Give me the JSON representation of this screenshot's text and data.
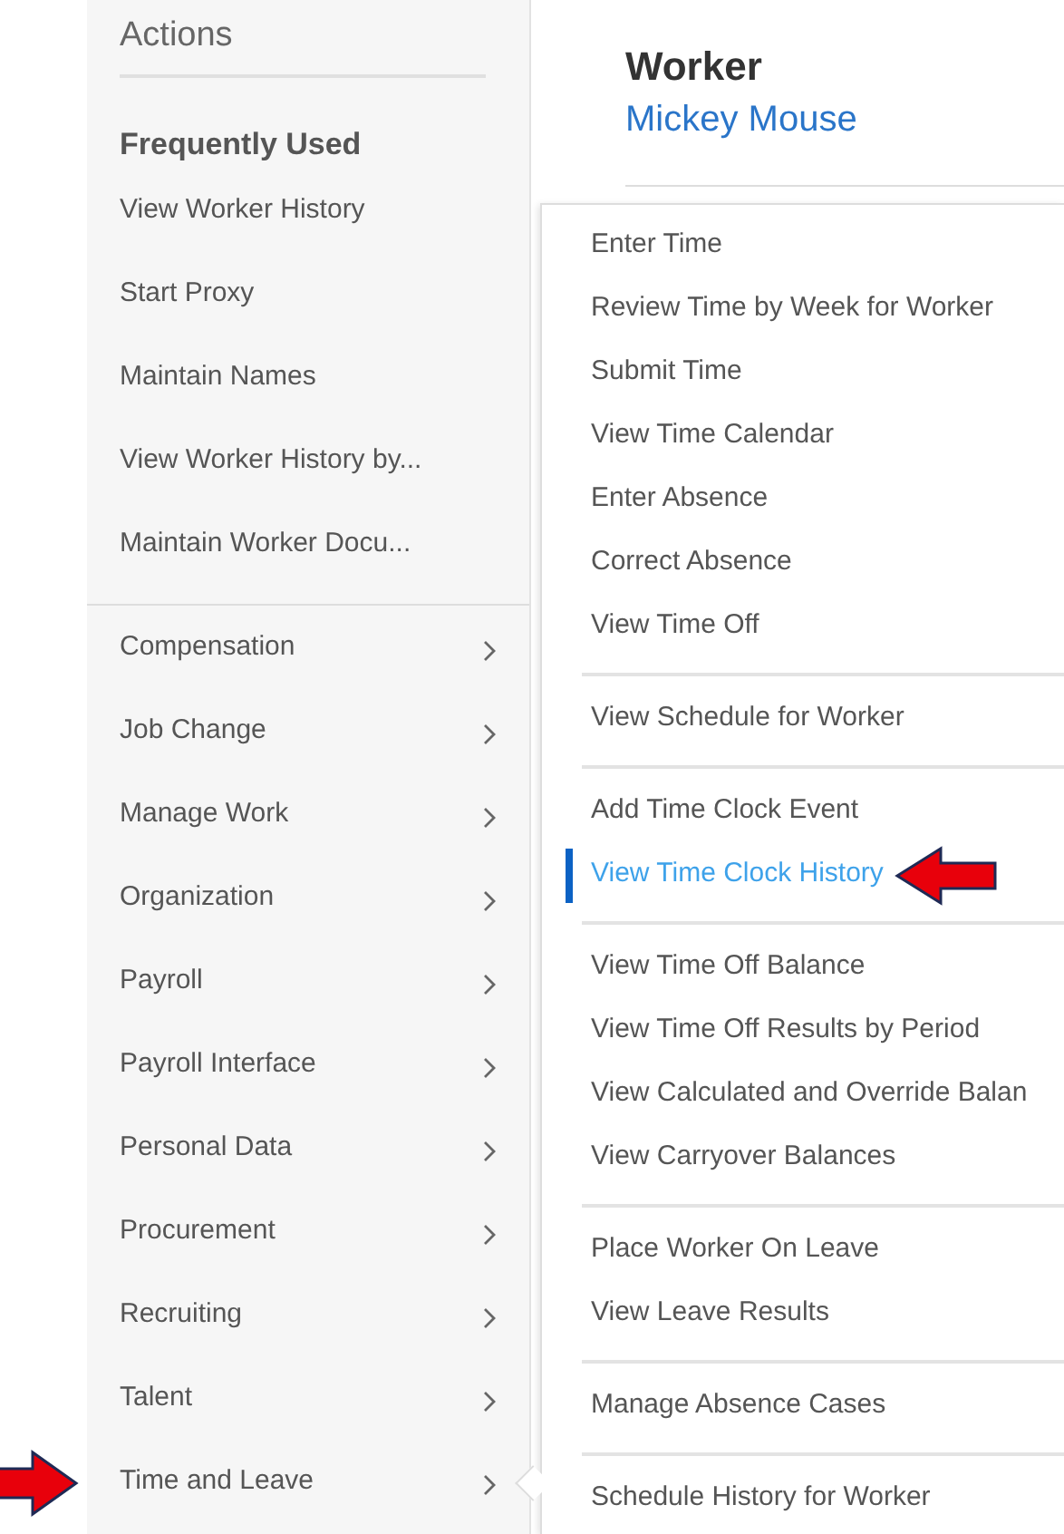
{
  "sidebar": {
    "title": "Actions",
    "section_title": "Frequently Used",
    "frequent_items": [
      "View Worker History",
      "Start Proxy",
      "Maintain Names",
      "View Worker History by...",
      "Maintain Worker Docu..."
    ],
    "categories": [
      {
        "label": "Compensation",
        "selected": false,
        "marked": false
      },
      {
        "label": "Job Change",
        "selected": false,
        "marked": false
      },
      {
        "label": "Manage Work",
        "selected": false,
        "marked": false
      },
      {
        "label": "Organization",
        "selected": false,
        "marked": false
      },
      {
        "label": "Payroll",
        "selected": false,
        "marked": false
      },
      {
        "label": "Payroll Interface",
        "selected": false,
        "marked": false
      },
      {
        "label": "Personal Data",
        "selected": false,
        "marked": false
      },
      {
        "label": "Procurement",
        "selected": false,
        "marked": false
      },
      {
        "label": "Recruiting",
        "selected": false,
        "marked": false
      },
      {
        "label": "Talent",
        "selected": false,
        "marked": false
      },
      {
        "label": "Time and Leave",
        "selected": true,
        "marked": true
      }
    ]
  },
  "header": {
    "title": "Worker",
    "name": "Mickey Mouse"
  },
  "menu": {
    "groups": [
      {
        "items": [
          {
            "label": "Enter Time",
            "selected": false,
            "marked": false
          },
          {
            "label": "Review Time by Week for Worker",
            "selected": false,
            "marked": false
          },
          {
            "label": "Submit Time",
            "selected": false,
            "marked": false
          },
          {
            "label": "View Time Calendar",
            "selected": false,
            "marked": false
          },
          {
            "label": "Enter Absence",
            "selected": false,
            "marked": false
          },
          {
            "label": "Correct Absence",
            "selected": false,
            "marked": false
          },
          {
            "label": "View Time Off",
            "selected": false,
            "marked": false
          }
        ]
      },
      {
        "items": [
          {
            "label": "View Schedule for Worker",
            "selected": false,
            "marked": false
          }
        ]
      },
      {
        "items": [
          {
            "label": "Add Time Clock Event",
            "selected": false,
            "marked": false
          },
          {
            "label": "View Time Clock History",
            "selected": true,
            "marked": true
          }
        ]
      },
      {
        "items": [
          {
            "label": "View Time Off Balance",
            "selected": false,
            "marked": false
          },
          {
            "label": "View Time Off Results by Period",
            "selected": false,
            "marked": false
          },
          {
            "label": "View Calculated and Override Balan",
            "selected": false,
            "marked": false
          },
          {
            "label": "View Carryover Balances",
            "selected": false,
            "marked": false
          }
        ]
      },
      {
        "items": [
          {
            "label": "Place Worker On Leave",
            "selected": false,
            "marked": false
          },
          {
            "label": "View Leave Results",
            "selected": false,
            "marked": false
          }
        ]
      },
      {
        "items": [
          {
            "label": "Manage Absence Cases",
            "selected": false,
            "marked": false
          }
        ]
      },
      {
        "items": [
          {
            "label": "Schedule History for Worker",
            "selected": false,
            "marked": false
          }
        ]
      }
    ]
  }
}
